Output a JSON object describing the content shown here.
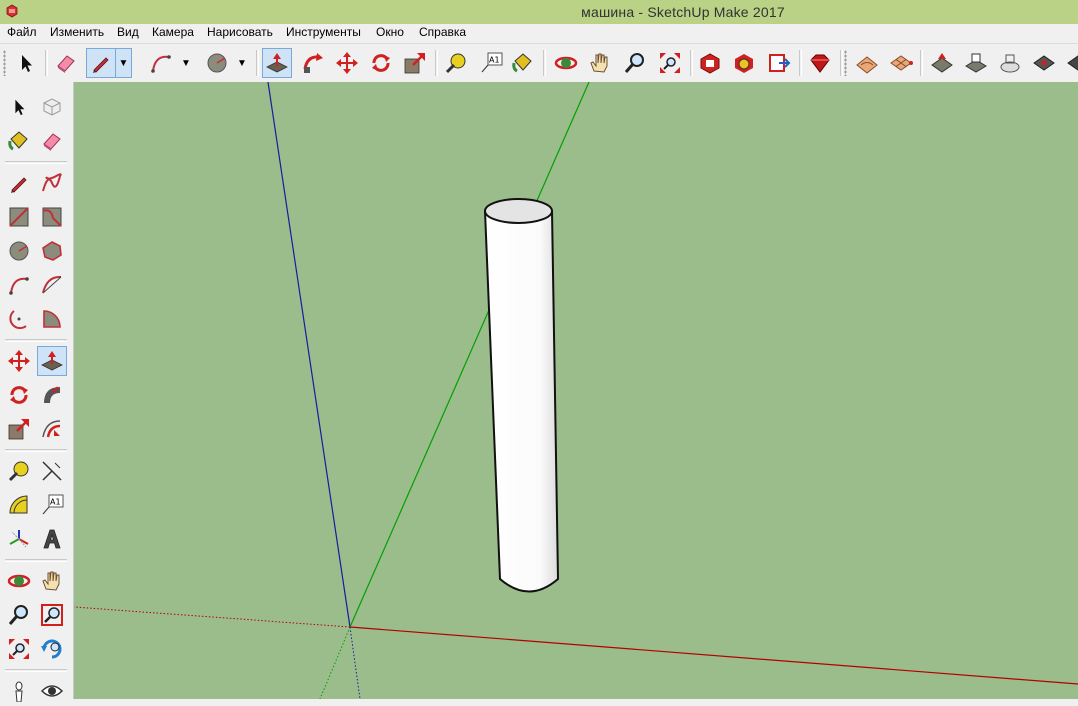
{
  "window": {
    "title": "машина - SketchUp Make 2017"
  },
  "menu": [
    {
      "label": "Файл"
    },
    {
      "label": "Изменить"
    },
    {
      "label": "Вид"
    },
    {
      "label": "Камера"
    },
    {
      "label": "Нарисовать"
    },
    {
      "label": "Инструменты"
    },
    {
      "label": "Окно"
    },
    {
      "label": "Справка"
    }
  ],
  "toolbar_top": {
    "tools": [
      "select-icon",
      "eraser-icon",
      "pencil-icon",
      "arc-icon",
      "circle-icon",
      "push-pull-icon",
      "follow-me-icon",
      "move-icon",
      "rotate-icon",
      "scale-icon",
      "tape-measure-icon",
      "text-label-icon",
      "paint-bucket-icon",
      "orbit-icon",
      "pan-icon",
      "zoom-icon",
      "zoom-extents-icon",
      "3d-warehouse-icon",
      "extension-warehouse-icon",
      "send-to-layout-icon",
      "ruby-console-icon",
      "sandbox-from-contours-icon",
      "sandbox-from-scratch-icon",
      "smoove-icon",
      "stamp-icon",
      "drape-icon",
      "add-detail-icon",
      "flip-edge-icon"
    ],
    "active_tools": [
      "pencil-icon",
      "push-pull-icon"
    ]
  },
  "toolbar_left": {
    "tools": [
      "select-icon",
      "make-component-icon",
      "paint-bucket-icon",
      "eraser-icon",
      "pencil-icon",
      "freehand-icon",
      "rectangle-icon",
      "rotated-rectangle-icon",
      "circle-icon",
      "polygon-icon",
      "arc-icon",
      "two-point-arc-icon",
      "three-point-arc-icon",
      "pie-icon",
      "move-icon",
      "push-pull-icon",
      "rotate-icon",
      "follow-me-icon",
      "scale-icon",
      "offset-icon",
      "tape-measure-icon",
      "dimension-icon",
      "protractor-icon",
      "text-icon",
      "axes-icon",
      "3d-text-icon",
      "orbit-icon",
      "pan-icon",
      "zoom-icon",
      "zoom-window-icon",
      "zoom-extents-icon",
      "previous-view-icon",
      "walk-icon",
      "look-around-icon"
    ],
    "active_tool": "push-pull-icon",
    "text_label_glyph": "A1"
  },
  "viewport": {
    "background_color": "#9bbd8c",
    "axis_colors": {
      "red": "#b40000",
      "green": "#00a000",
      "blue": "#1a1aa0"
    },
    "model": "cylinder"
  }
}
